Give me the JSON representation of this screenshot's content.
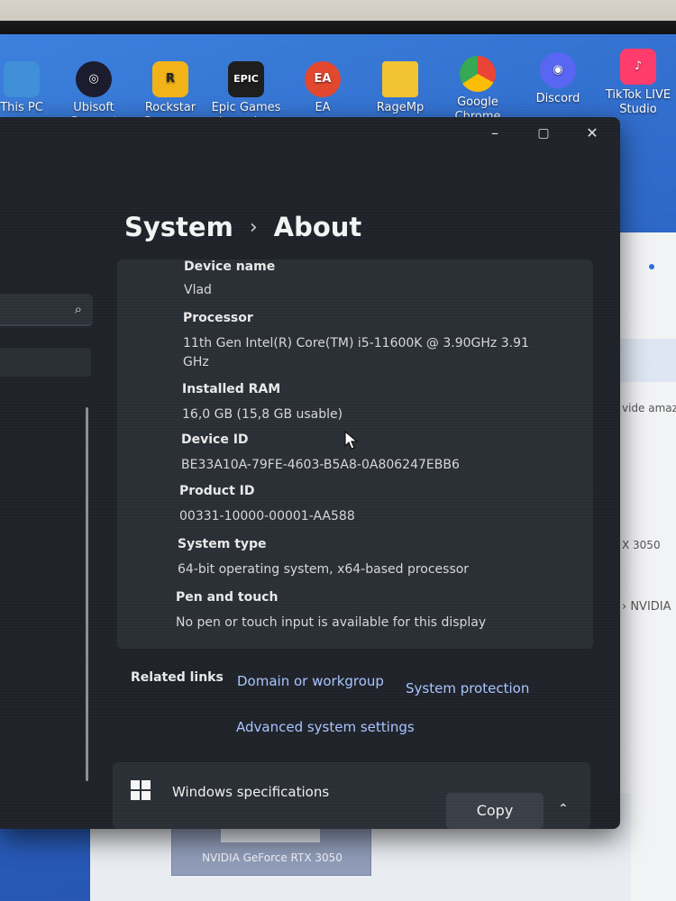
{
  "desktop": {
    "icons": [
      {
        "label": "This PC",
        "color": "#3e8fd8",
        "glyph": ""
      },
      {
        "label": "Ubisoft Connect",
        "color": "#1b1b2e",
        "glyph": "◎"
      },
      {
        "label": "Rockstar Games ...",
        "color": "#f2b318",
        "glyph": "R"
      },
      {
        "label": "Epic Games Launcher",
        "color": "#1d1d1d",
        "glyph": "EPIC"
      },
      {
        "label": "EA",
        "color": "#e2472d",
        "glyph": "EA"
      },
      {
        "label": "RageMp",
        "color": "#f1c232",
        "glyph": ""
      },
      {
        "label": "Google Chrome",
        "color": "#34a853",
        "glyph": "●"
      },
      {
        "label": "Discord",
        "color": "#5865f2",
        "glyph": "◉"
      },
      {
        "label": "TikTok LIVE Studio",
        "color": "#ff3b6b",
        "glyph": "♪"
      }
    ]
  },
  "background_window": {
    "snippet1": "vide amaz",
    "snippet2": "X 3050",
    "snippet3": "› NVIDIA",
    "gpu_card_label": "NVIDIA GeForce RTX 3050"
  },
  "window": {
    "controls": {
      "minimize": "–",
      "maximize": "▢",
      "close": "✕"
    },
    "breadcrumb": {
      "parent": "System",
      "separator": "›",
      "current": "About"
    },
    "specs": [
      {
        "label": "Device name",
        "value": "Vlad"
      },
      {
        "label": "Processor",
        "value": "11th Gen Intel(R) Core(TM) i5-11600K @ 3.90GHz   3.91",
        "value2": "GHz"
      },
      {
        "label": "Installed RAM",
        "value": "16,0 GB (15,8 GB usable)"
      },
      {
        "label": "Device ID",
        "value": "BE33A10A-79FE-4603-B5A8-0A806247EBB6"
      },
      {
        "label": "Product ID",
        "value": "00331-10000-00001-AA588"
      },
      {
        "label": "System type",
        "value": "64-bit operating system, x64-based processor"
      },
      {
        "label": "Pen and touch",
        "value": "No pen or touch input is available for this display"
      }
    ],
    "related": {
      "label": "Related links",
      "domain": "Domain or workgroup",
      "protection": "System protection",
      "advanced": "Advanced system settings"
    },
    "windows_spec": {
      "title": "Windows specifications",
      "copy": "Copy"
    }
  }
}
